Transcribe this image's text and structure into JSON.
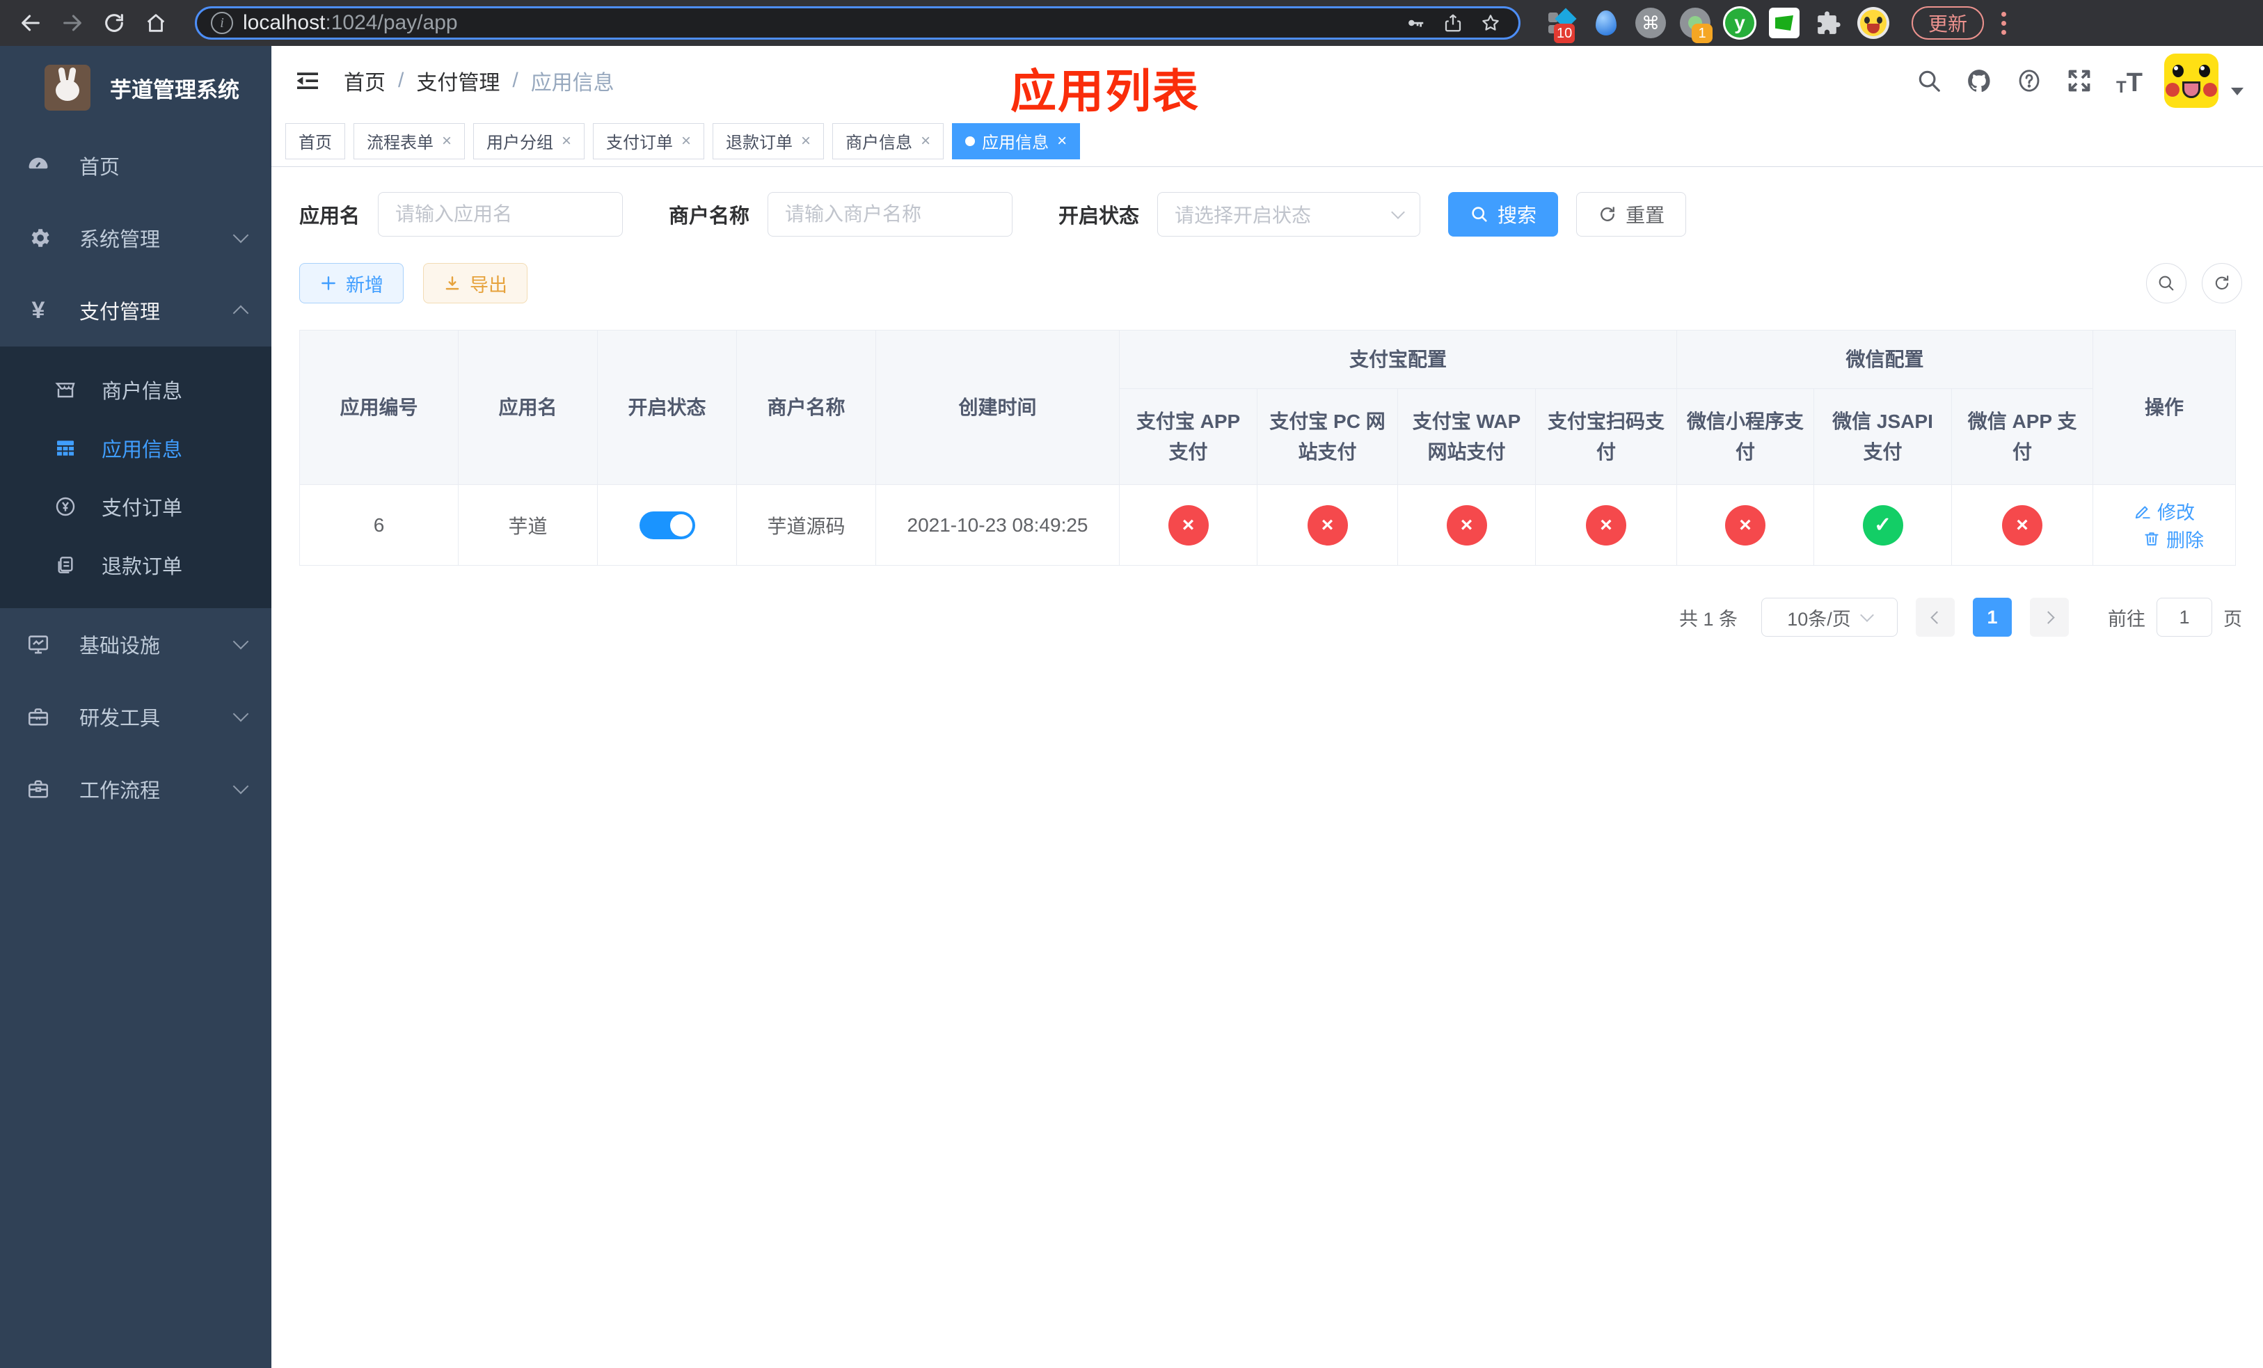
{
  "browser": {
    "url_host": "localhost",
    "url_path": ":1024/pay/app",
    "update_label": "更新",
    "ext_badge_a": "10",
    "ext_badge_b": "1",
    "ext_y_label": "y"
  },
  "sidebar": {
    "title": "芋道管理系统",
    "items": [
      {
        "label": "首页",
        "expandable": false
      },
      {
        "label": "系统管理",
        "expandable": true
      },
      {
        "label": "支付管理",
        "expandable": true,
        "expanded": true
      },
      {
        "label": "基础设施",
        "expandable": true
      },
      {
        "label": "研发工具",
        "expandable": true
      },
      {
        "label": "工作流程",
        "expandable": true
      }
    ],
    "submenu": [
      {
        "label": "商户信息",
        "active": false
      },
      {
        "label": "应用信息",
        "active": true
      },
      {
        "label": "支付订单",
        "active": false
      },
      {
        "label": "退款订单",
        "active": false
      }
    ]
  },
  "navbar": {
    "breadcrumb": [
      "首页",
      "支付管理",
      "应用信息"
    ],
    "separator": "/",
    "annotation": "应用列表"
  },
  "tabs": {
    "items": [
      {
        "label": "首页",
        "closable": false,
        "active": false
      },
      {
        "label": "流程表单",
        "closable": true,
        "active": false
      },
      {
        "label": "用户分组",
        "closable": true,
        "active": false
      },
      {
        "label": "支付订单",
        "closable": true,
        "active": false
      },
      {
        "label": "退款订单",
        "closable": true,
        "active": false
      },
      {
        "label": "商户信息",
        "closable": true,
        "active": false
      },
      {
        "label": "应用信息",
        "closable": true,
        "active": true
      }
    ]
  },
  "filter": {
    "app_name_label": "应用名",
    "app_name_placeholder": "请输入应用名",
    "merchant_label": "商户名称",
    "merchant_placeholder": "请输入商户名称",
    "status_label": "开启状态",
    "status_placeholder": "请选择开启状态",
    "search_label": "搜索",
    "reset_label": "重置"
  },
  "toolbar": {
    "add_label": "新增",
    "export_label": "导出"
  },
  "table": {
    "simple_headers": [
      "应用编号",
      "应用名",
      "开启状态",
      "商户名称",
      "创建时间"
    ],
    "groups": [
      {
        "label": "支付宝配置",
        "colspan": 4
      },
      {
        "label": "微信配置",
        "colspan": 3
      }
    ],
    "sub_headers": [
      "支付宝 APP 支付",
      "支付宝 PC 网站支付",
      "支付宝 WAP 网站支付",
      "支付宝扫码支付",
      "微信小程序支付",
      "微信 JSAPI 支付",
      "微信 APP 支付"
    ],
    "ops_header": "操作",
    "rows": [
      {
        "id": "6",
        "name": "芋道",
        "enabled": true,
        "merchant": "芋道源码",
        "created": "2021-10-23 08:49:25",
        "channels": [
          false,
          false,
          false,
          false,
          false,
          true,
          false
        ],
        "edit_label": "修改",
        "delete_label": "删除"
      }
    ]
  },
  "pagination": {
    "total_label": "共 1 条",
    "page_size_label": "10条/页",
    "current_page": "1",
    "goto_label": "前往",
    "goto_value": "1",
    "page_unit": "页"
  },
  "icons": {
    "check": "✓",
    "cross": "×",
    "close": "×",
    "command": "⌘"
  },
  "colors": {
    "accent": "#409eff",
    "toggle_on": "#1a94ff",
    "success": "#13ce66",
    "danger": "#f5494c",
    "warning": "#e6a23c",
    "annotation": "#fa2d0a",
    "sidebar_bg": "#304156",
    "submenu_bg": "#1f2d3d"
  }
}
